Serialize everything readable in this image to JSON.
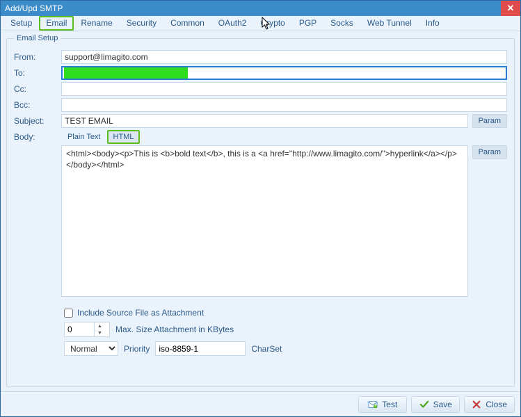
{
  "window": {
    "title": "Add/Upd SMTP"
  },
  "tabs": [
    "Setup",
    "Email",
    "Rename",
    "Security",
    "Common",
    "OAuth2",
    "Crypto",
    "PGP",
    "Socks",
    "Web Tunnel",
    "Info"
  ],
  "active_tab_index": 1,
  "group": {
    "legend": "Email Setup"
  },
  "labels": {
    "from": "From:",
    "to": "To:",
    "cc": "Cc:",
    "bcc": "Bcc:",
    "subject": "Subject:",
    "body": "Body:",
    "param": "Param",
    "plain_text": "Plain Text",
    "html": "HTML",
    "include_attachment": "Include Source File as Attachment",
    "max_size": "Max. Size Attachment in KBytes",
    "priority": "Priority",
    "charset": "CharSet"
  },
  "fields": {
    "from": "support@limagito.com",
    "to": "",
    "cc": "",
    "bcc": "",
    "subject": "TEST EMAIL",
    "body": "<html><body><p>This is <b>bold text</b>, this is a <a href=\"http://www.limagito.com/\">hyperlink</a></p></body></html>",
    "include_attachment": false,
    "max_size": "0",
    "priority": "Normal",
    "charset": "iso-8859-1"
  },
  "body_tabs": {
    "active": "html"
  },
  "footer": {
    "test": "Test",
    "save": "Save",
    "close": "Close"
  },
  "icons": {
    "close_x": "✕"
  }
}
